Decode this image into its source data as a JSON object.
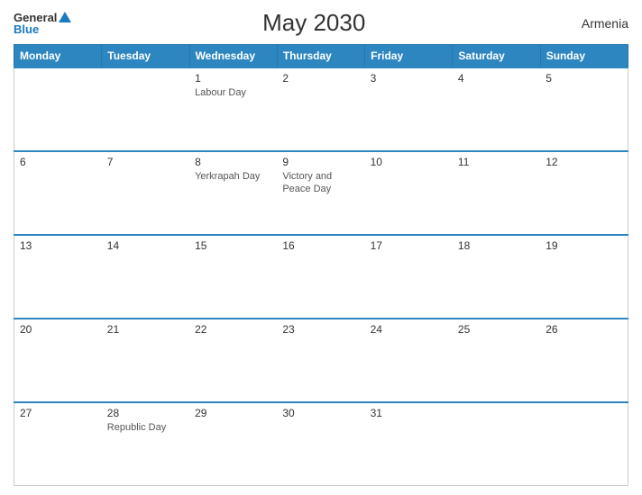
{
  "logo": {
    "general": "General",
    "blue": "Blue",
    "triangle": "▲"
  },
  "title": "May 2030",
  "country": "Armenia",
  "header_days": [
    "Monday",
    "Tuesday",
    "Wednesday",
    "Thursday",
    "Friday",
    "Saturday",
    "Sunday"
  ],
  "weeks": [
    [
      {
        "day": "",
        "holiday": "",
        "empty": true
      },
      {
        "day": "",
        "holiday": "",
        "empty": true
      },
      {
        "day": "1",
        "holiday": "Labour Day",
        "empty": false
      },
      {
        "day": "2",
        "holiday": "",
        "empty": false
      },
      {
        "day": "3",
        "holiday": "",
        "empty": false
      },
      {
        "day": "4",
        "holiday": "",
        "empty": false
      },
      {
        "day": "5",
        "holiday": "",
        "empty": false
      }
    ],
    [
      {
        "day": "6",
        "holiday": "",
        "empty": false
      },
      {
        "day": "7",
        "holiday": "",
        "empty": false
      },
      {
        "day": "8",
        "holiday": "Yerkrapah Day",
        "empty": false
      },
      {
        "day": "9",
        "holiday": "Victory and Peace Day",
        "empty": false
      },
      {
        "day": "10",
        "holiday": "",
        "empty": false
      },
      {
        "day": "11",
        "holiday": "",
        "empty": false
      },
      {
        "day": "12",
        "holiday": "",
        "empty": false
      }
    ],
    [
      {
        "day": "13",
        "holiday": "",
        "empty": false
      },
      {
        "day": "14",
        "holiday": "",
        "empty": false
      },
      {
        "day": "15",
        "holiday": "",
        "empty": false
      },
      {
        "day": "16",
        "holiday": "",
        "empty": false
      },
      {
        "day": "17",
        "holiday": "",
        "empty": false
      },
      {
        "day": "18",
        "holiday": "",
        "empty": false
      },
      {
        "day": "19",
        "holiday": "",
        "empty": false
      }
    ],
    [
      {
        "day": "20",
        "holiday": "",
        "empty": false
      },
      {
        "day": "21",
        "holiday": "",
        "empty": false
      },
      {
        "day": "22",
        "holiday": "",
        "empty": false
      },
      {
        "day": "23",
        "holiday": "",
        "empty": false
      },
      {
        "day": "24",
        "holiday": "",
        "empty": false
      },
      {
        "day": "25",
        "holiday": "",
        "empty": false
      },
      {
        "day": "26",
        "holiday": "",
        "empty": false
      }
    ],
    [
      {
        "day": "27",
        "holiday": "",
        "empty": false
      },
      {
        "day": "28",
        "holiday": "Republic Day",
        "empty": false
      },
      {
        "day": "29",
        "holiday": "",
        "empty": false
      },
      {
        "day": "30",
        "holiday": "",
        "empty": false
      },
      {
        "day": "31",
        "holiday": "",
        "empty": false
      },
      {
        "day": "",
        "holiday": "",
        "empty": true
      },
      {
        "day": "",
        "holiday": "",
        "empty": true
      }
    ]
  ]
}
